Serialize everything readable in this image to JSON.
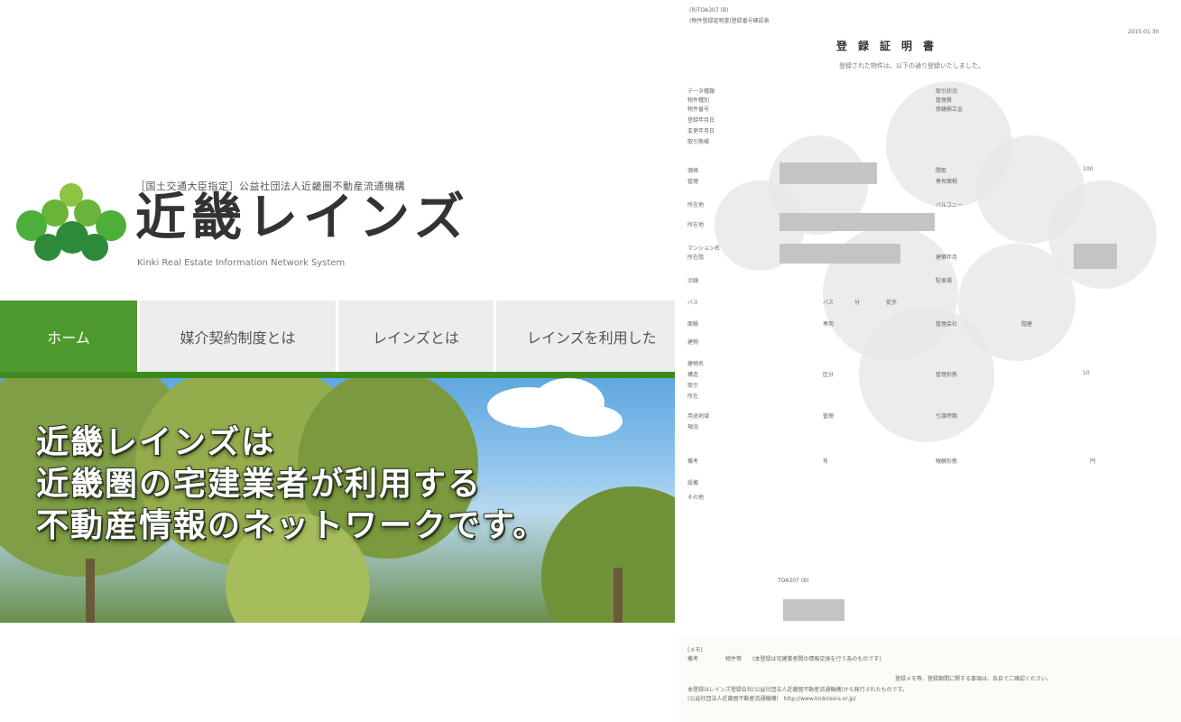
{
  "site": {
    "pretitle": "［国土交通大臣指定］公益社団法人近畿圏不動産流通機構",
    "title": "近畿レインズ",
    "subtitle": "Kinki Real Estate Information Network System",
    "nav": [
      "ホーム",
      "媒介契約制度とは",
      "レインズとは",
      "レインズを利用した"
    ],
    "hero_lines": [
      "近畿レインズは",
      "近畿圏の宅建業者が利用する",
      "不動産情報のネットワークです。"
    ],
    "colors": {
      "accent": "#4e9a2e",
      "logo_dark": "#2d8a3a",
      "logo_light": "#8cc63f"
    }
  },
  "doc": {
    "header": [
      "(R)TOA307 (B)",
      "(物件登録証明書)登録番号確認表"
    ],
    "date": "2015.01.30",
    "title": "登録証明書",
    "subtitle": "登録された物件は、以下の通り登録いたしました。",
    "rows_left": [
      "データ種類",
      "物件種別",
      "物件番号",
      "登録年月日",
      "変更年月日",
      "取引態様",
      "価格",
      "管理",
      "所在地",
      "所在地",
      "マンション名",
      "所在階",
      "沿線",
      "バス",
      "面積",
      "建物",
      "建物名",
      "構造",
      "取引",
      "所在",
      "用途地域",
      "現況",
      "備考",
      "設備",
      "その他"
    ],
    "rows_right": [
      "取引状況",
      "管理費",
      "修繕積立金",
      "間取",
      "専有面積",
      "バルコニー",
      "建築年月",
      "駐車場",
      "管理会社",
      "管理形態",
      "引渡時期",
      "報酬形態"
    ],
    "table_vals": [
      "100",
      "10",
      "専用",
      "有",
      "円",
      "区分",
      "管理",
      "バス",
      "分",
      "徒歩",
      "階建",
      "TOA307 (B)"
    ],
    "footer": [
      "(メモ)",
      "備考　　　　　物件等　　(本登録は宅建業者間の情報交換を行う為のものです)",
      "登録メモ等、登録期間に関する事項は、各自でご確認ください。",
      "本登録はレインズ登録会社(公益社団法人近畿圏不動産流通機構)から発行されたものです。",
      "(公益社団法人近畿圏不動産流通機構)　http://www.kinkireins.or.jp/"
    ]
  }
}
